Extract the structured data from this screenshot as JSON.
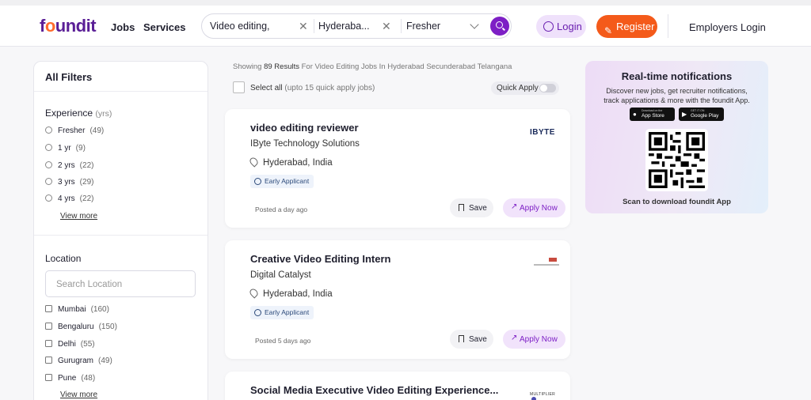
{
  "header": {
    "logo": {
      "f": "f",
      "o": "o",
      "rest": "undit"
    },
    "nav": {
      "jobs": "Jobs",
      "services": "Services"
    },
    "search": {
      "keyword": "Video editing,",
      "location": "Hyderaba...",
      "experience": "Fresher"
    },
    "login": "Login",
    "register": "Register",
    "employers": "Employers Login"
  },
  "filters": {
    "title": "All Filters",
    "experience": {
      "label": "Experience",
      "unit": "(yrs)",
      "options": [
        {
          "label": "Fresher",
          "count": "(49)"
        },
        {
          "label": "1 yr",
          "count": "(9)"
        },
        {
          "label": "2 yrs",
          "count": "(22)"
        },
        {
          "label": "3 yrs",
          "count": "(29)"
        },
        {
          "label": "4 yrs",
          "count": "(22)"
        }
      ],
      "view_more": "View more"
    },
    "location": {
      "label": "Location",
      "placeholder": "Search  Location",
      "options": [
        {
          "label": "Mumbai",
          "count": "(160)"
        },
        {
          "label": "Bengaluru",
          "count": "(150)"
        },
        {
          "label": "Delhi",
          "count": "(55)"
        },
        {
          "label": "Gurugram",
          "count": "(49)"
        },
        {
          "label": "Pune",
          "count": "(48)"
        }
      ],
      "view_more": "View more"
    }
  },
  "results": {
    "prefix": "Showing",
    "count": "89 Results",
    "suffix": "For Video Editing Jobs In Hyderabad Secunderabad Telangana",
    "select_all": "Select all",
    "select_hint": "(upto 15 quick apply jobs)",
    "quick_apply": "Quick Apply"
  },
  "jobs": [
    {
      "title": "video editing reviewer",
      "company": "IByte Technology Solutions",
      "location": "Hyderabad, India",
      "badge": "Early Applicant",
      "posted": "Posted a day ago",
      "save": "Save",
      "apply": "Apply Now",
      "logo_text": "IBYTE"
    },
    {
      "title": "Creative Video Editing Intern",
      "company": "Digital Catalyst",
      "location": "Hyderabad, India",
      "badge": "Early Applicant",
      "posted": "Posted 5 days ago",
      "save": "Save",
      "apply": "Apply Now",
      "logo_text": ""
    },
    {
      "title": "Social Media Executive Video Editing Experience...",
      "logo_text": "MULTIPLIER"
    }
  ],
  "promo": {
    "title": "Real-time notifications",
    "subtitle_1": "Discover new jobs, get recruiter notifications,",
    "subtitle_2": "track applications & more with the foundit App.",
    "app_store_top": "Download on the",
    "app_store": "App Store",
    "google_play_top": "GET IT ON",
    "google_play": "Google Play",
    "scan": "Scan to download foundit App"
  }
}
